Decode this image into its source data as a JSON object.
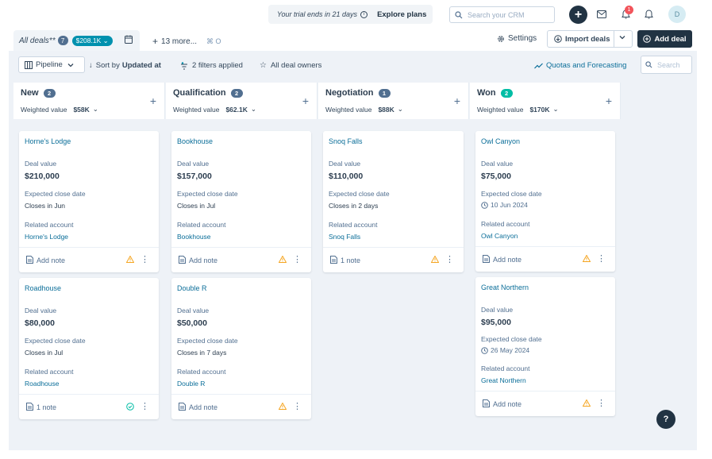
{
  "topbar": {
    "trial_text": "Your trial ends in 21 days",
    "explore_label": "Explore plans",
    "search_placeholder": "Search your CRM",
    "notification_count": "1",
    "avatar_initial": "D"
  },
  "views": {
    "current_name": "All deals**",
    "current_count": "7",
    "current_value": "$208.1K",
    "more_label": "13 more...",
    "more_shortcut": "⌘ O"
  },
  "actions": {
    "settings_label": "Settings",
    "import_label": "Import deals",
    "add_deal_label": "Add deal"
  },
  "toolbar": {
    "pipeline_label": "Pipeline",
    "sort_prefix": "Sort by",
    "sort_value": "Updated at",
    "filters_label": "2 filters applied",
    "owners_label": "All deal owners",
    "quotas_label": "Quotas and Forecasting",
    "search_placeholder": "Search"
  },
  "labels": {
    "weighted_value": "Weighted value",
    "deal_value": "Deal value",
    "expected_close": "Expected close date",
    "related_account": "Related account"
  },
  "columns": [
    {
      "title": "New",
      "count": "2",
      "weighted": "$58K",
      "cards": [
        {
          "name": "Horne's Lodge",
          "value": "$210,000",
          "close": "Closes in Jun",
          "account": "Horne's Lodge",
          "footer": "Add note",
          "status": "warning"
        },
        {
          "name": "Roadhouse",
          "value": "$80,000",
          "close": "Closes in Jul",
          "account": "Roadhouse",
          "footer": "1 note",
          "status": "ok"
        }
      ]
    },
    {
      "title": "Qualification",
      "count": "2",
      "weighted": "$62.1K",
      "cards": [
        {
          "name": "Bookhouse",
          "value": "$157,000",
          "close": "Closes in Jul",
          "account": "Bookhouse",
          "footer": "Add note",
          "status": "warning"
        },
        {
          "name": "Double R",
          "value": "$50,000",
          "close": "Closes in 7 days",
          "account": "Double R",
          "footer": "Add note",
          "status": "warning"
        }
      ]
    },
    {
      "title": "Negotiation",
      "count": "1",
      "weighted": "$88K",
      "cards": [
        {
          "name": "Snoq Falls",
          "value": "$110,000",
          "close": "Closes in 2 days",
          "account": "Snoq Falls",
          "footer": "1 note",
          "status": "warning"
        }
      ]
    },
    {
      "title": "Won",
      "count": "2",
      "weighted": "$170K",
      "cards": [
        {
          "name": "Owl Canyon",
          "value": "$75,000",
          "close": "10 Jun 2024",
          "account": "Owl Canyon",
          "footer": "Add note",
          "status": "warning"
        },
        {
          "name": "Great Northern",
          "value": "$95,000",
          "close": "26 May 2024",
          "account": "Great Northern",
          "footer": "Add note",
          "status": "warning"
        }
      ]
    }
  ],
  "help_label": "?",
  "colors": {
    "primary_dark": "#213343",
    "link": "#0b6e99",
    "board_bg": "#eef2f7",
    "won_badge": "#00bda5",
    "warning": "#f5a623"
  }
}
